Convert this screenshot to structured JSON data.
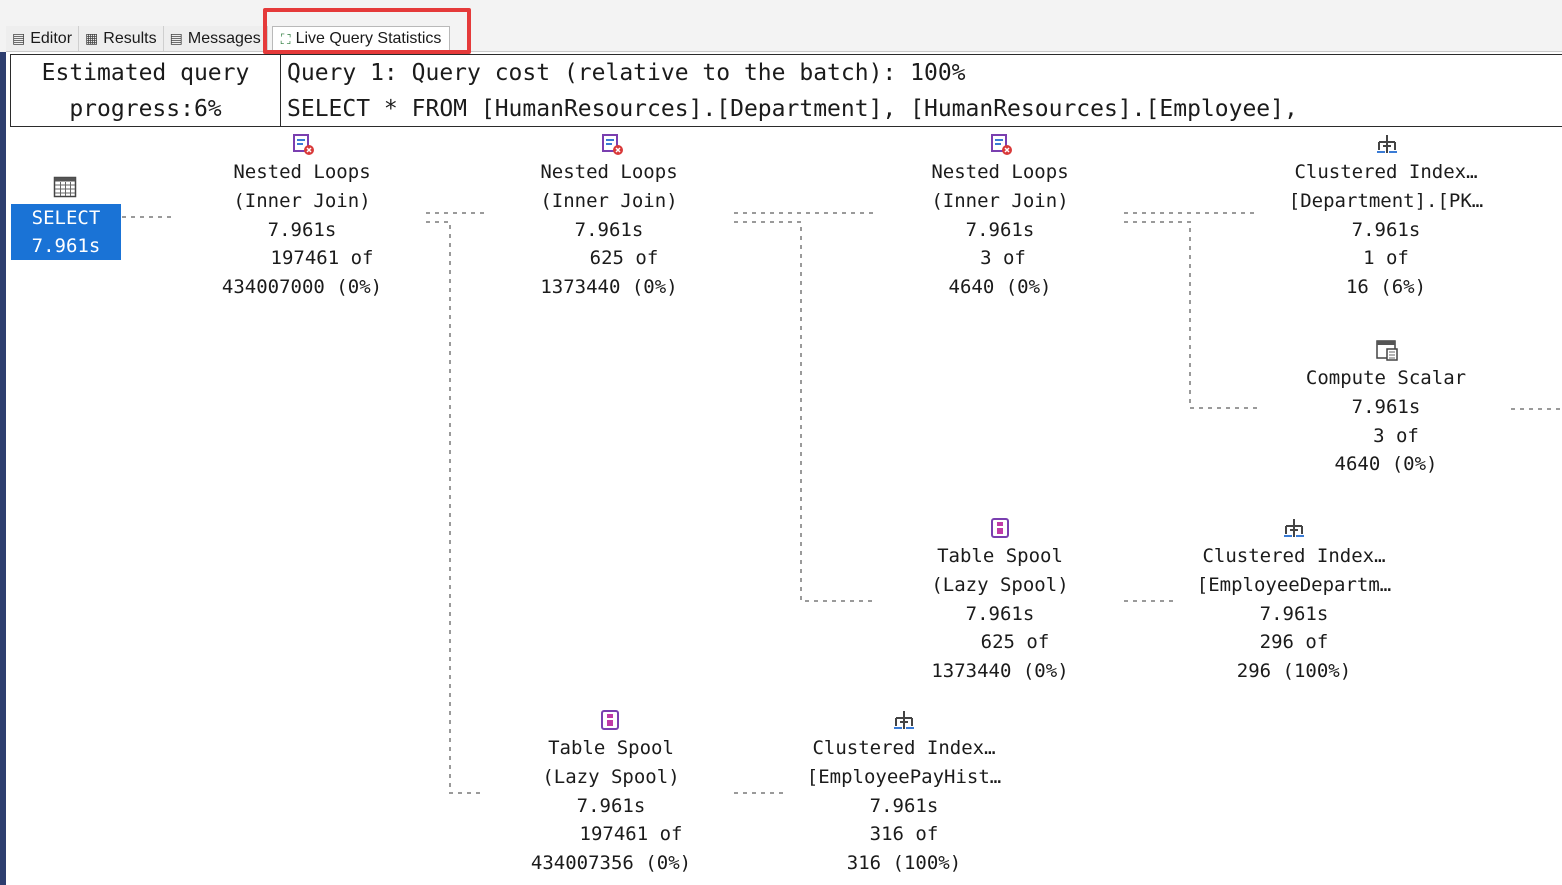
{
  "tabs": [
    {
      "label": "Editor",
      "icon": "editor-icon"
    },
    {
      "label": "Results",
      "icon": "grid-icon"
    },
    {
      "label": "Messages",
      "icon": "messages-icon"
    },
    {
      "label": "Live Query Statistics",
      "icon": "live-stats-icon",
      "active": true
    }
  ],
  "header": {
    "progress_line1": "Estimated query",
    "progress_line2": "progress:6%",
    "query_line1": "Query 1: Query cost (relative to the batch): 100%",
    "query_line2": "SELECT * FROM [HumanResources].[Department], [HumanResources].[Employee],"
  },
  "plan": {
    "select": {
      "label": "SELECT",
      "time": "7.961s",
      "icon": "select-result-icon"
    },
    "nodes": [
      {
        "id": "nl1",
        "icon": "nested-loops-icon",
        "lines": [
          "Nested Loops",
          "(Inner Join)",
          "7.961s",
          "197461 of",
          "434007000 (0%)"
        ]
      },
      {
        "id": "nl2",
        "icon": "nested-loops-icon",
        "lines": [
          "Nested Loops",
          "(Inner Join)",
          "7.961s",
          "625 of",
          "1373440 (0%)"
        ]
      },
      {
        "id": "nl3",
        "icon": "nested-loops-icon",
        "lines": [
          "Nested Loops",
          "(Inner Join)",
          "7.961s",
          "3 of",
          "4640 (0%)"
        ]
      },
      {
        "id": "ci_dept",
        "icon": "clustered-index-icon",
        "lines": [
          "Clustered Index…",
          "[Department].[PK…",
          "7.961s",
          "1 of",
          "16 (6%)"
        ]
      },
      {
        "id": "compute",
        "icon": "compute-scalar-icon",
        "lines": [
          "Compute Scalar",
          "7.961s",
          "3 of",
          "4640 (0%)"
        ]
      },
      {
        "id": "spool1",
        "icon": "table-spool-icon",
        "lines": [
          "Table Spool",
          "(Lazy Spool)",
          "7.961s",
          "625 of",
          "1373440 (0%)"
        ]
      },
      {
        "id": "ci_edh",
        "icon": "clustered-index-icon",
        "lines": [
          "Clustered Index…",
          "[EmployeeDepartm…",
          "7.961s",
          "296 of",
          "296 (100%)"
        ]
      },
      {
        "id": "spool2",
        "icon": "table-spool-icon",
        "lines": [
          "Table Spool",
          "(Lazy Spool)",
          "7.961s",
          "197461 of",
          "434007356 (0%)"
        ]
      },
      {
        "id": "ci_eph",
        "icon": "clustered-index-icon",
        "lines": [
          "Clustered Index…",
          "[EmployeePayHist…",
          "7.961s",
          "316 of",
          "316 (100%)"
        ]
      }
    ]
  },
  "colors": {
    "accent": "#1a73d6",
    "highlight": "#e53a3a",
    "connector": "#9a9a9a",
    "operator_icon": "#7a3fb0"
  }
}
